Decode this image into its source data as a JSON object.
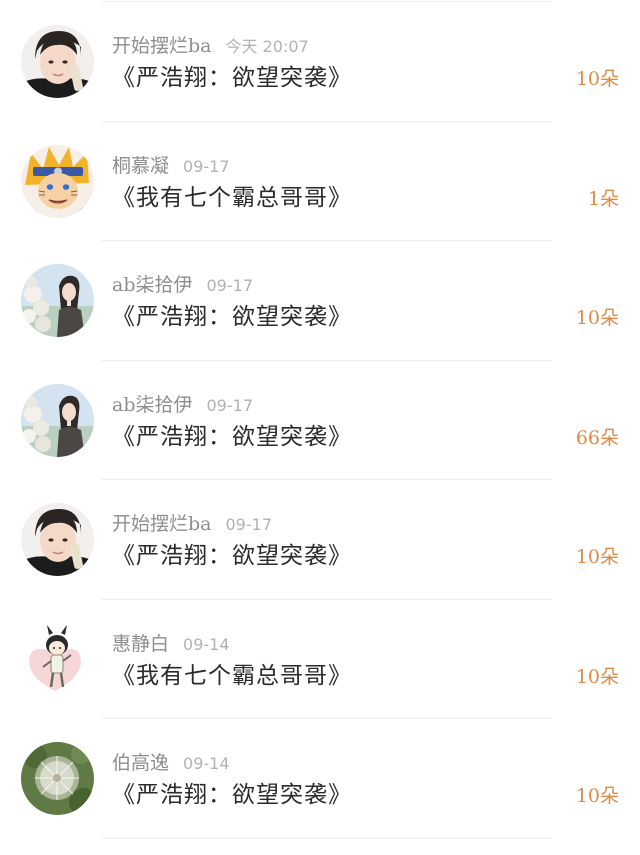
{
  "gift_records": [
    {
      "user": "开始摆烂ba",
      "time": "今天 20:07",
      "book": "《严浩翔：欲望突袭》",
      "flowers": "10朵",
      "avatar_icon": "young-man-portrait"
    },
    {
      "user": "桐慕凝",
      "time": "09-17",
      "book": "《我有七个霸总哥哥》",
      "flowers": "1朵",
      "avatar_icon": "anime-ninja-portrait"
    },
    {
      "user": "ab柒拾伊",
      "time": "09-17",
      "book": "《严浩翔：欲望突袭》",
      "flowers": "10朵",
      "avatar_icon": "girl-with-flowers-portrait"
    },
    {
      "user": "ab柒拾伊",
      "time": "09-17",
      "book": "《严浩翔：欲望突袭》",
      "flowers": "66朵",
      "avatar_icon": "girl-with-flowers-portrait"
    },
    {
      "user": "开始摆烂ba",
      "time": "09-17",
      "book": "《严浩翔：欲望突袭》",
      "flowers": "10朵",
      "avatar_icon": "young-man-portrait"
    },
    {
      "user": "惠静白",
      "time": "09-14",
      "book": "《我有七个霸总哥哥》",
      "flowers": "10朵",
      "avatar_icon": "cartoon-chibi-portrait"
    },
    {
      "user": "伯高逸",
      "time": "09-14",
      "book": "《严浩翔：欲望突袭》",
      "flowers": "10朵",
      "avatar_icon": "dandelion-photo"
    }
  ],
  "colors": {
    "flower_count": "#e08a45",
    "username": "#8e8e8e",
    "timestamp": "#b2b2b2",
    "book_title": "#2b2b2b",
    "divider": "#ededed"
  }
}
